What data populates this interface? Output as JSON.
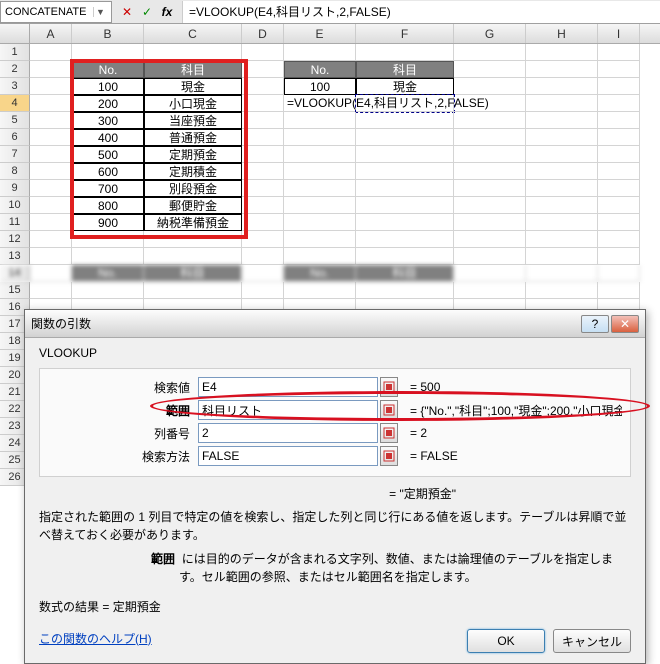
{
  "formula_bar": {
    "name_box": "CONCATENATE",
    "cancel_icon": "✕",
    "enter_icon": "✓",
    "fx_icon": "fx",
    "formula": "=VLOOKUP(E4,科目リスト,2,FALSE)"
  },
  "columns": [
    "A",
    "B",
    "C",
    "D",
    "E",
    "F",
    "G",
    "H",
    "I"
  ],
  "table1": {
    "headers": [
      "No.",
      "科目"
    ],
    "rows": [
      [
        "100",
        "現金"
      ],
      [
        "200",
        "小口現金"
      ],
      [
        "300",
        "当座預金"
      ],
      [
        "400",
        "普通預金"
      ],
      [
        "500",
        "定期預金"
      ],
      [
        "600",
        "定期積金"
      ],
      [
        "700",
        "別段預金"
      ],
      [
        "800",
        "郵便貯金"
      ],
      [
        "900",
        "納税準備預金"
      ]
    ]
  },
  "table2": {
    "headers": [
      "No.",
      "科目"
    ],
    "rows": [
      [
        "100",
        "現金"
      ]
    ],
    "formula_display": "=VLOOKUP(E4,科目リスト,2,FALSE)"
  },
  "peek_headers_b": "No.",
  "peek_headers_c": "科目",
  "peek_headers_e": "No.",
  "peek_headers_f": "科目",
  "dialog": {
    "title": "関数の引数",
    "help_glyph": "?",
    "close_glyph": "✕",
    "func_name": "VLOOKUP",
    "args": [
      {
        "label": "検索値",
        "value": "E4",
        "eval": "= 500",
        "bold": false
      },
      {
        "label": "範囲",
        "value": "科目リスト",
        "eval": "= {\"No.\",\"科目\";100,\"現金\";200,\"小口現金",
        "bold": true
      },
      {
        "label": "列番号",
        "value": "2",
        "eval": "= 2",
        "bold": false
      },
      {
        "label": "検索方法",
        "value": "FALSE",
        "eval": "= FALSE",
        "bold": false
      }
    ],
    "func_eval": "= \"定期預金\"",
    "desc_main": "指定された範囲の 1 列目で特定の値を検索し、指定した列と同じ行にある値を返します。テーブルは昇順で並べ替えておく必要があります。",
    "desc_arg_label": "範囲",
    "desc_arg_text": "には目的のデータが含まれる文字列、数値、または論理値のテーブルを指定します。セル範囲の参照、またはセル範囲名を指定します。",
    "result_label": "数式の結果 = ",
    "result_value": "定期預金",
    "help_link": "この関数のヘルプ(H)",
    "ok": "OK",
    "cancel": "キャンセル"
  }
}
